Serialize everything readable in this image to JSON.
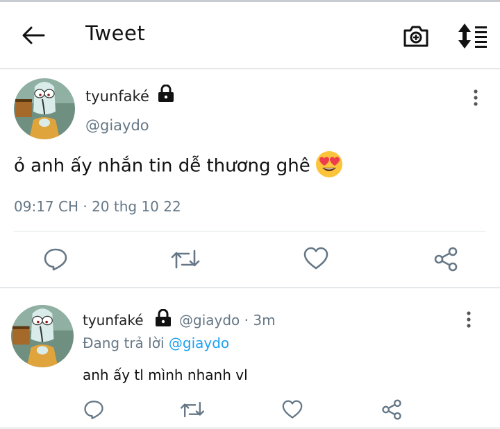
{
  "header": {
    "title": "Tweet",
    "back_icon": "arrow-left-icon",
    "camera_icon": "camera-plus-icon",
    "sort_icon": "sort-list-icon"
  },
  "main_tweet": {
    "display_name": "tyunfaké",
    "handle": "@giaydo",
    "locked": true,
    "text": "ỏ anh ấy nhắn tin dễ thương ghê",
    "emoji": "heart-eyes-emoji",
    "timestamp": "09:17 CH · 20 thg 10 22",
    "actions": [
      "reply-icon",
      "retweet-icon",
      "like-icon",
      "share-icon"
    ]
  },
  "reply_tweet": {
    "display_name": "tyunfaké",
    "handle_time": "@giaydo · 3m",
    "replying_prefix": "Đang trả lời",
    "replying_to": "@giaydo",
    "text": "anh ấy tl mình nhanh vl",
    "actions": [
      "reply-icon",
      "retweet-icon",
      "like-icon",
      "share-icon"
    ]
  },
  "colors": {
    "accent": "#1da1f2",
    "secondary_text": "#657786",
    "icon": "#657786"
  }
}
